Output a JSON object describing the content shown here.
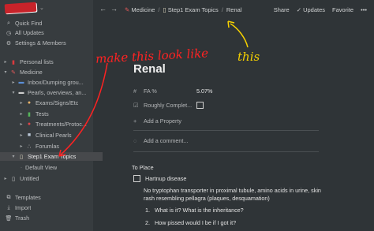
{
  "sidebar": {
    "items": [
      {
        "icon": "search-icon",
        "glyph": "⌕",
        "label": "Quick Find"
      },
      {
        "icon": "clock-icon",
        "glyph": "◷",
        "label": "All Updates"
      },
      {
        "icon": "gear-icon",
        "glyph": "⚙",
        "label": "Settings & Members"
      }
    ],
    "tree": [
      {
        "label": "Personal lists",
        "icon": "notebook-icon",
        "glyph": "▮",
        "color": "#d9393e",
        "level": 0,
        "expanded": false
      },
      {
        "label": "Medicine",
        "icon": "syringe-icon",
        "glyph": "✎",
        "color": "#e45a5a",
        "level": 0,
        "expanded": true
      },
      {
        "label": "Inbox/Dumping grou...",
        "icon": "inbox-icon",
        "glyph": "▬",
        "color": "#5b8fd9",
        "level": 1,
        "expanded": false
      },
      {
        "label": "Pearls, overviews, an...",
        "icon": "pearl-icon",
        "glyph": "▬",
        "color": "#cfcfcf",
        "level": 1,
        "expanded": false
      },
      {
        "label": "Exams/Signs/Etc",
        "icon": "person-icon",
        "glyph": "●",
        "color": "#e8b46a",
        "level": 2,
        "expanded": false
      },
      {
        "label": "Tests",
        "icon": "test-tube-icon",
        "glyph": "▮",
        "color": "#56b35b",
        "level": 2,
        "expanded": false
      },
      {
        "label": "Treatments/Protoc...",
        "icon": "pill-icon",
        "glyph": "●",
        "color": "#e0454a",
        "level": 2,
        "expanded": false
      },
      {
        "label": "Clinical Pearls",
        "icon": "pearl-image-icon",
        "glyph": "■",
        "color": "#b9c6d6",
        "level": 2,
        "expanded": false
      },
      {
        "label": "Forumlas",
        "icon": "formula-icon",
        "glyph": "∴",
        "color": "#cfcfcf",
        "level": 2,
        "expanded": false
      },
      {
        "label": "Step1 Exam Topics",
        "icon": "page-icon",
        "glyph": "▯",
        "color": "#e8e1c8",
        "level": 0,
        "expanded": true
      },
      {
        "label": "Default View",
        "icon": "",
        "glyph": "",
        "color": "#cfcfcf",
        "level": 1,
        "expanded": null
      },
      {
        "label": "Untitled",
        "icon": "page-icon",
        "glyph": "▯",
        "color": "#cfcfcf",
        "level": 0,
        "expanded": false
      }
    ],
    "bottom": [
      {
        "icon": "templates-icon",
        "glyph": "⧉",
        "label": "Templates"
      },
      {
        "icon": "import-icon",
        "glyph": "⤓",
        "label": "Import"
      },
      {
        "icon": "trash-icon",
        "glyph": "🗑",
        "label": "Trash"
      }
    ]
  },
  "topbar": {
    "back": "←",
    "forward": "→",
    "breadcrumbs": [
      {
        "icon": "syringe-icon",
        "glyph": "✎",
        "label": "Medicine"
      },
      {
        "icon": "page-icon",
        "glyph": "▯",
        "label": "Step1 Exam Topics"
      },
      {
        "icon": "",
        "glyph": "",
        "label": "Renal"
      }
    ],
    "separator": "/",
    "share": "Share",
    "updates": "Updates",
    "favorite": "Favorite",
    "more": "•••"
  },
  "page": {
    "title": "Renal",
    "properties": [
      {
        "icon": "hash-icon",
        "glyph": "#",
        "name": "FA %",
        "value": "5.07%"
      },
      {
        "icon": "checkbox-icon",
        "glyph": "☑",
        "name": "Roughly Complet...",
        "value": ""
      }
    ],
    "add_property": "Add a Property",
    "add_comment": "Add a comment...",
    "section_heading": "To Place",
    "todo": "Hartnup disease",
    "description": "No tryptophan transporter in proximal tubule, amino acids in urine, skin rash resembling pellagra (plaques, desquamation)",
    "list": [
      {
        "num": "1.",
        "text": "What is it?  What is the inheritance?"
      },
      {
        "num": "2.",
        "text": "How pissed would I be if I got it?"
      }
    ]
  },
  "annotations": {
    "red_text": "make this look like",
    "yellow_text": "this",
    "red_color": "#ff2222",
    "yellow_color": "#f5d000"
  }
}
